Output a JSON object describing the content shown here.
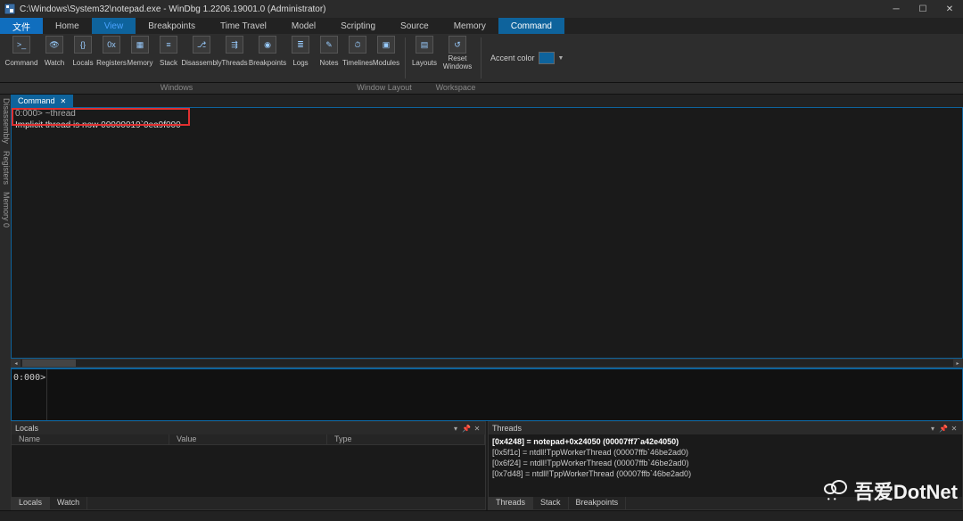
{
  "window": {
    "title": "C:\\Windows\\System32\\notepad.exe   - WinDbg 1.2206.19001.0 (Administrator)"
  },
  "menu": {
    "file": "文件",
    "home": "Home",
    "view": "View",
    "breakpoints": "Breakpoints",
    "timetravel": "Time Travel",
    "model": "Model",
    "scripting": "Scripting",
    "source": "Source",
    "memory": "Memory",
    "command": "Command"
  },
  "ribbon": {
    "command": "Command",
    "watch": "Watch",
    "locals": "Locals",
    "registers": "Registers",
    "memory": "Memory",
    "stack": "Stack",
    "disassembly": "Disassembly",
    "threads": "Threads",
    "breakpoints": "Breakpoints",
    "logs": "Logs",
    "notes": "Notes",
    "timelines": "Timelines",
    "modules": "Modules",
    "layouts": "Layouts",
    "resetwindows": "Reset\nWindows",
    "accentlabel": "Accent color",
    "groups": {
      "windows": "Windows",
      "windowlayout": "Window Layout",
      "workspace": "Workspace"
    }
  },
  "sidetabs": {
    "disassembly": "Disassembly",
    "registers": "Registers",
    "memory": "Memory 0"
  },
  "commandpanel": {
    "tab": "Command",
    "line1": "0:000> ~thread",
    "line2": "Implicit thread is now 00000019`0ea9f000",
    "prompt": "0:000>"
  },
  "locals": {
    "title": "Locals",
    "cols": {
      "name": "Name",
      "value": "Value",
      "type": "Type"
    },
    "footer": {
      "locals": "Locals",
      "watch": "Watch"
    }
  },
  "threads": {
    "title": "Threads",
    "rows": [
      "[0x4248] = notepad+0x24050 (00007ff7`a42e4050)",
      "[0x5f1c] = ntdll!TppWorkerThread (00007ffb`46be2ad0)",
      "[0x6f24] = ntdll!TppWorkerThread (00007ffb`46be2ad0)",
      "[0x7d48] = ntdll!TppWorkerThread (00007ffb`46be2ad0)"
    ],
    "footer": {
      "threads": "Threads",
      "stack": "Stack",
      "breakpoints": "Breakpoints"
    }
  },
  "watermark": "吾爱DotNet"
}
